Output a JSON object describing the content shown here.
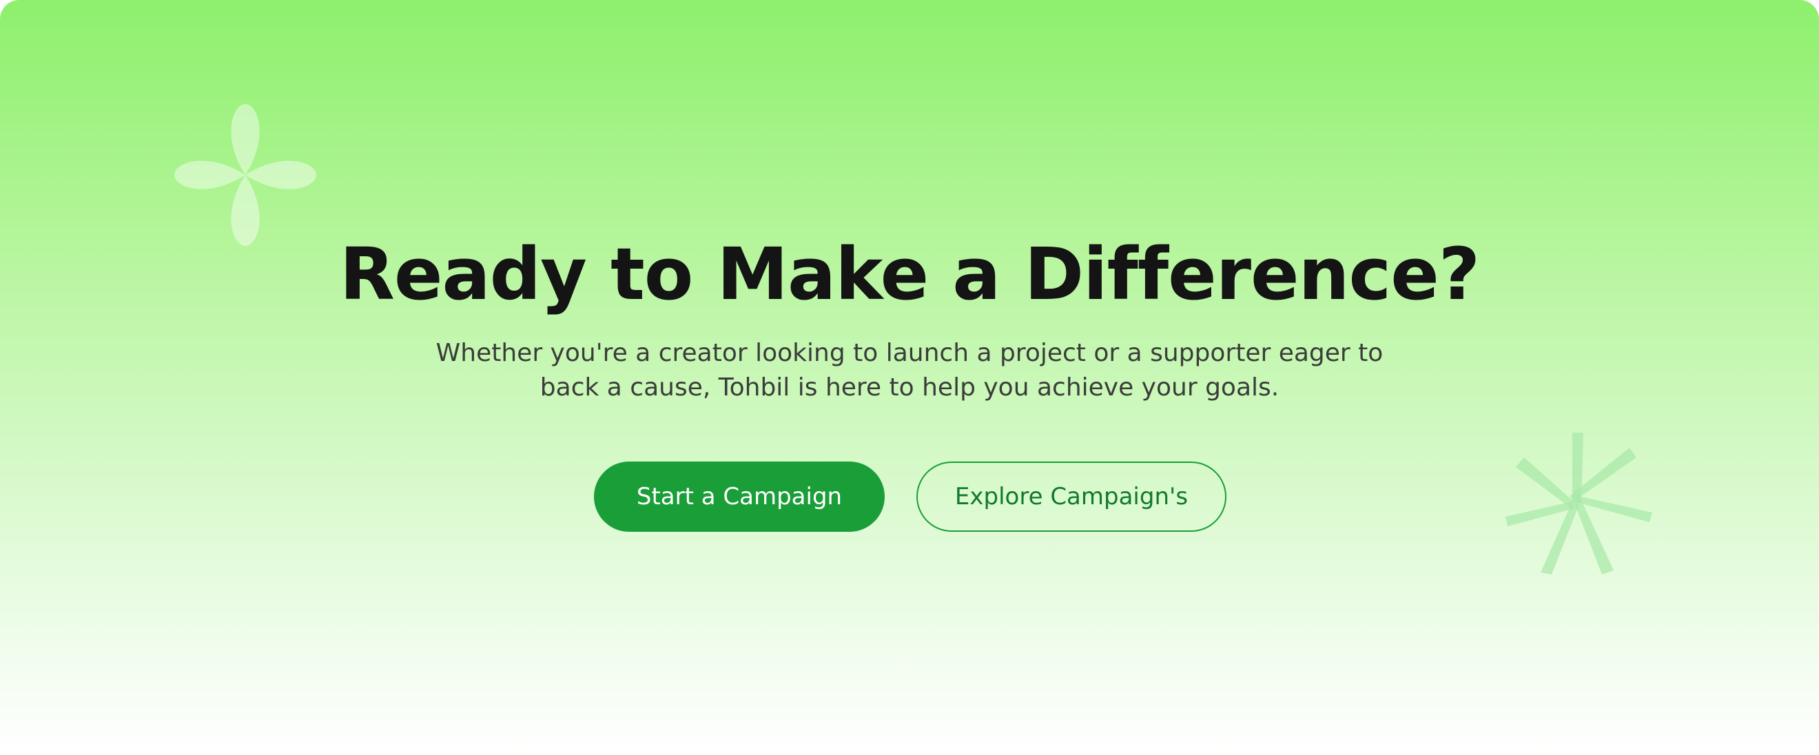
{
  "cta": {
    "headline": "Ready to Make a Difference?",
    "description": "Whether you're a creator looking to launch a project or a supporter eager to back a cause, Tohbil is here to help you achieve your goals.",
    "primary_button_label": "Start a Campaign",
    "secondary_button_label": "Explore Campaign's"
  },
  "decorations": {
    "left_icon": "four-petal-flower-icon",
    "right_icon": "asterisk-icon"
  },
  "colors": {
    "gradient_top": "#8df06c",
    "gradient_bottom": "#ffffff",
    "primary_button": "#1a9e38",
    "secondary_button_text": "#127a2c",
    "headline_text": "#141414",
    "body_text": "#3a3d3a"
  }
}
